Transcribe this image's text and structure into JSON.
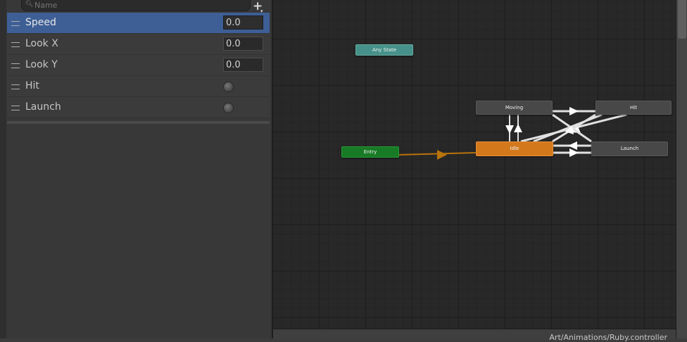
{
  "parameters_panel": {
    "search": {
      "placeholder": "Name",
      "icon": "search-icon"
    },
    "add_button": {
      "icon": "plus-dropdown-icon"
    },
    "parameters": [
      {
        "name": "Speed",
        "type": "float",
        "value": "0.0",
        "selected": true
      },
      {
        "name": "Look X",
        "type": "float",
        "value": "0.0",
        "selected": false
      },
      {
        "name": "Look Y",
        "type": "float",
        "value": "0.0",
        "selected": false
      },
      {
        "name": "Hit",
        "type": "trigger",
        "value": "",
        "selected": false
      },
      {
        "name": "Launch",
        "type": "trigger",
        "value": "",
        "selected": false
      }
    ]
  },
  "graph": {
    "states": {
      "any_state": "Any State",
      "entry": "Entry",
      "idle": "Idle",
      "moving": "Moving",
      "hit": "Hit",
      "launch": "Launch"
    },
    "default_state": "Idle",
    "colors": {
      "default_state": "#d3791c",
      "entry": "#177a24",
      "any_state": "#46928a",
      "state": "#484848",
      "transition": "#e1e1e1",
      "entry_transition": "#b8730c"
    }
  },
  "status_bar": {
    "asset_path": "Art/Animations/Ruby.controller"
  }
}
